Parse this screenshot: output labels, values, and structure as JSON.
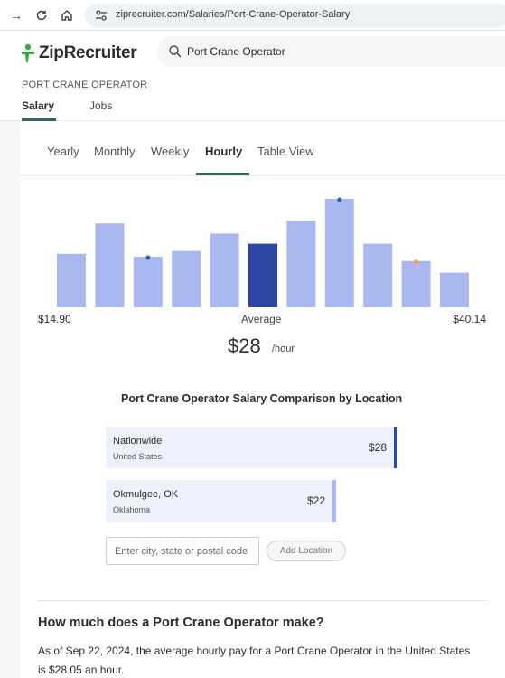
{
  "browser": {
    "url": "ziprecruiter.com/Salaries/Port-Crane-Operator-Salary"
  },
  "header": {
    "logo_text": "ZipRecruiter",
    "search_value": "Port Crane Operator"
  },
  "subheader": {
    "job_title": "PORT CRANE OPERATOR",
    "tabs": [
      {
        "label": "Salary",
        "active": true
      },
      {
        "label": "Jobs",
        "active": false
      }
    ]
  },
  "period_tabs": [
    {
      "label": "Yearly",
      "active": false
    },
    {
      "label": "Monthly",
      "active": false
    },
    {
      "label": "Weekly",
      "active": false
    },
    {
      "label": "Hourly",
      "active": true
    },
    {
      "label": "Table View",
      "active": false
    }
  ],
  "chart_data": {
    "type": "bar",
    "values": [
      0.37,
      0.58,
      0.35,
      0.39,
      0.51,
      0.44,
      0.6,
      0.75,
      0.44,
      0.32,
      0.24
    ],
    "highlight_index": 5,
    "markers": [
      {
        "bar": 2,
        "color": "#2a5bd7"
      },
      {
        "bar": 7,
        "color": "#2a5bd7"
      },
      {
        "bar": 9,
        "color": "#f0a050"
      }
    ],
    "min_label": "$14.90",
    "max_label": "$40.14",
    "average_label": "Average",
    "average_value": "$28",
    "average_unit": "/hour",
    "colors": {
      "bar": "#a9b9ef",
      "highlight": "#2d47a4"
    }
  },
  "comparison": {
    "title": "Port Crane Operator Salary Comparison by Location",
    "locations": [
      {
        "name": "Nationwide",
        "region": "United States",
        "value": "$28",
        "fraction": 1.0,
        "accent": "#2d47a4"
      },
      {
        "name": "Okmulgee, OK",
        "region": "Oklahoma",
        "value": "$22",
        "fraction": 0.79,
        "accent": "#a9b9ef"
      }
    ],
    "input_placeholder": "Enter city, state or postal code",
    "add_button": "Add Location"
  },
  "faq": {
    "title": "How much does a Port Crane Operator make?",
    "body": "As of Sep 22, 2024, the average hourly pay for a Port Crane Operator in the United States is $28.05 an hour."
  },
  "colors": {
    "accent_green": "#2d6a4f",
    "logo_green": "#36a845"
  }
}
